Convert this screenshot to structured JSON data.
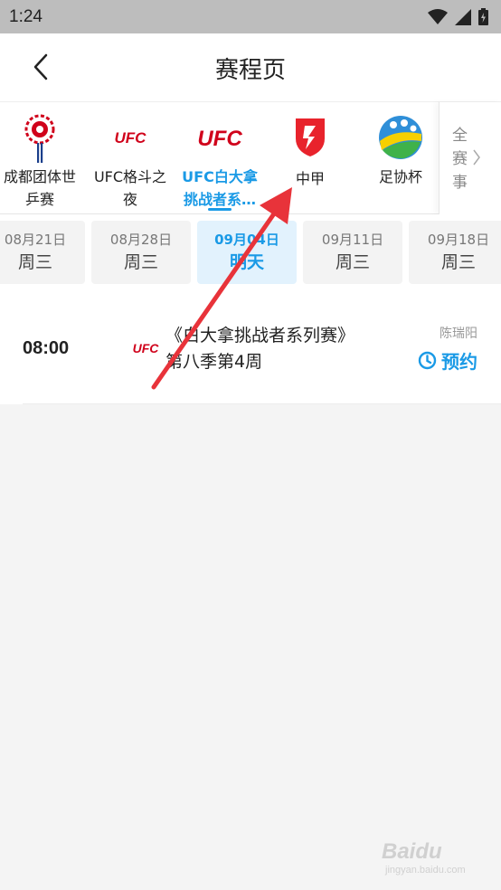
{
  "status_bar": {
    "time": "1:24"
  },
  "header": {
    "title": "赛程页"
  },
  "categories": [
    {
      "label": "成都团体世乒赛",
      "icon": "pingpong-championship-logo"
    },
    {
      "label": "UFC格斗之夜",
      "icon": "ufc-logo",
      "logo_text": "UFC"
    },
    {
      "label": "UFC白大拿挑战者系…",
      "icon": "ufc-logo",
      "logo_text": "UFC",
      "active": true
    },
    {
      "label": "中甲",
      "icon": "china-league-one-logo"
    },
    {
      "label": "足协杯",
      "icon": "fa-cup-logo"
    }
  ],
  "all_categories": {
    "label": "全赛事",
    "chevron": "〉"
  },
  "dates": [
    {
      "date": "08月21日",
      "weekday": "周三"
    },
    {
      "date": "08月28日",
      "weekday": "周三"
    },
    {
      "date": "09月04日",
      "weekday": "明天",
      "active": true
    },
    {
      "date": "09月11日",
      "weekday": "周三"
    },
    {
      "date": "09月18日",
      "weekday": "周三"
    }
  ],
  "match": {
    "time": "08:00",
    "logo_text": "UFC",
    "title": "《白大拿挑战者系列赛》第八季第4周",
    "anchor": "陈瑞阳",
    "reserve_label": "预约"
  },
  "watermark": {
    "brand": "Baidu",
    "sub": "jingyan.baidu.com"
  },
  "colors": {
    "accent": "#1a9ae6",
    "ufc_red": "#d0021b",
    "arrow": "#e8333a",
    "status_bar": "#bdbdbd"
  }
}
